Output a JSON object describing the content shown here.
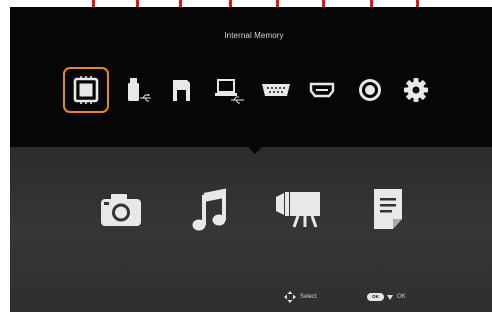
{
  "menu": {
    "title": "Internal Memory",
    "sources": [
      {
        "icon": "internal-memory-icon",
        "selected": true
      },
      {
        "icon": "usb-drive-icon",
        "selected": false
      },
      {
        "icon": "sd-card-icon",
        "selected": false
      },
      {
        "icon": "pc-usb-icon",
        "selected": false
      },
      {
        "icon": "vga-port-icon",
        "selected": false
      },
      {
        "icon": "hdmi-port-icon",
        "selected": false
      },
      {
        "icon": "video-input-icon",
        "selected": false
      },
      {
        "icon": "settings-gear-icon",
        "selected": false
      }
    ]
  },
  "media": [
    {
      "icon": "camera-icon"
    },
    {
      "icon": "music-note-icon"
    },
    {
      "icon": "video-camera-icon"
    },
    {
      "icon": "document-icon"
    }
  ],
  "hints": {
    "select_label": "Select",
    "ok_badge": "OK",
    "ok_label": "OK"
  },
  "colors": {
    "callout": "#e0161c",
    "selection_border": "#e68a1c",
    "top_background": "#060606",
    "panel_background": "#333333",
    "icon": "#e8e8e8"
  }
}
